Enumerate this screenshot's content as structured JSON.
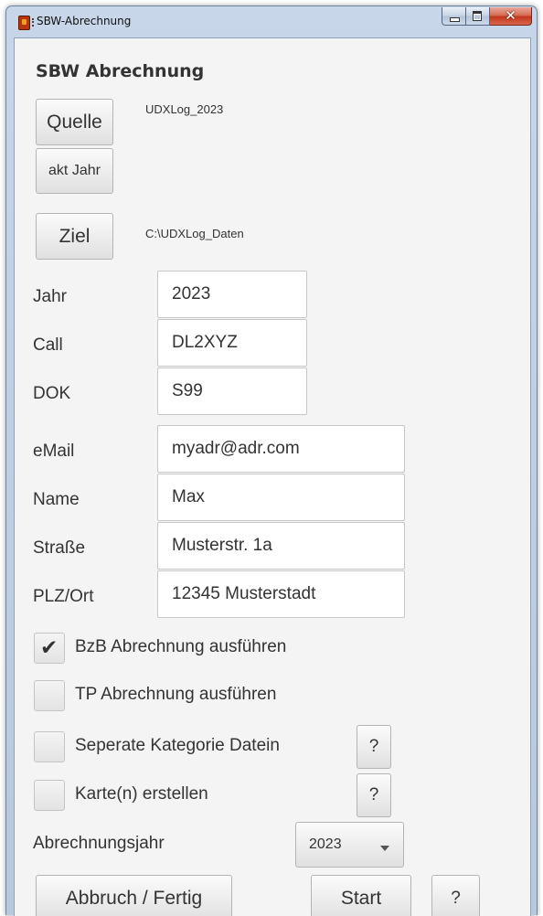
{
  "window": {
    "title": "SBW-Abrechnung"
  },
  "app": {
    "heading": "SBW Abrechnung"
  },
  "source": {
    "button_label": "Quelle",
    "path": "UDXLog_2023",
    "current_year_button": "akt Jahr"
  },
  "target": {
    "button_label": "Ziel",
    "path": "C:\\UDXLog_Daten"
  },
  "form": {
    "year": {
      "label": "Jahr",
      "value": "2023"
    },
    "call": {
      "label": "Call",
      "value": "DL2XYZ"
    },
    "dok": {
      "label": "DOK",
      "value": "S99"
    },
    "email": {
      "label": "eMail",
      "value": "myadr@adr.com"
    },
    "name": {
      "label": "Name",
      "value": "Max"
    },
    "street": {
      "label": "Straße",
      "value": "Musterstr. 1a"
    },
    "zip_city": {
      "label": "PLZ/Ort",
      "value": "12345 Musterstadt"
    }
  },
  "options": {
    "bzb": {
      "label": "BzB Abrechnung ausführen",
      "checked": true
    },
    "tp": {
      "label": "TP Abrechnung ausführen",
      "checked": false
    },
    "separate": {
      "label": "Seperate Kategorie Datein",
      "checked": false,
      "help": "?"
    },
    "maps": {
      "label": "Karte(n) erstellen",
      "checked": false,
      "help": "?"
    }
  },
  "billing_year": {
    "label": "Abrechnungsjahr",
    "selected": "2023"
  },
  "footer": {
    "cancel_label": "Abbruch / Fertig",
    "start_label": "Start",
    "help_label": "?"
  }
}
